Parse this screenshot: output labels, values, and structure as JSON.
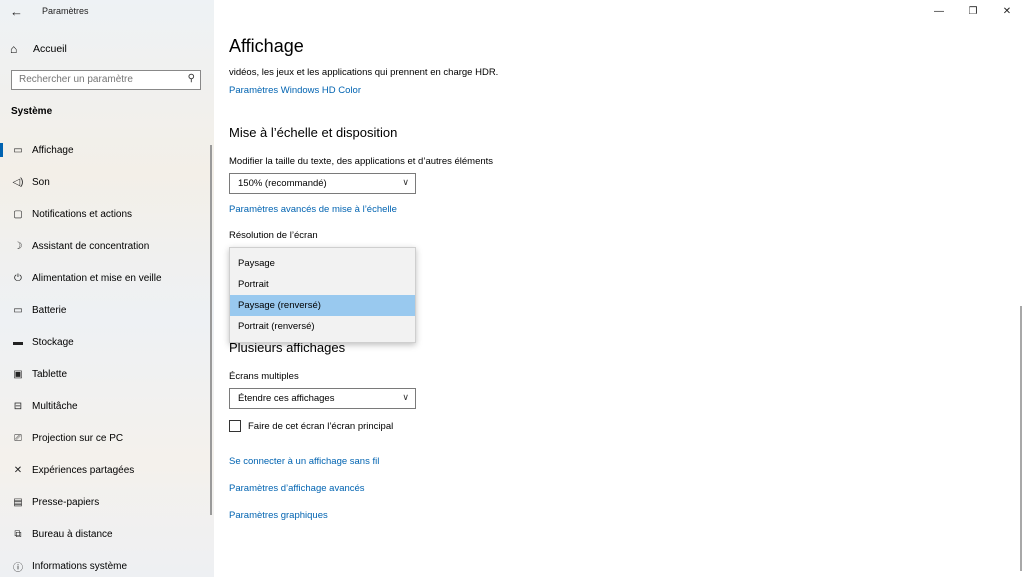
{
  "window": {
    "title": "Paramètres",
    "back_glyph": "←",
    "minimize": "—",
    "restore": "❐",
    "close": "✕"
  },
  "sidebar": {
    "home": "Accueil",
    "search_placeholder": "Rechercher un paramètre",
    "section": "Système",
    "items": [
      {
        "label": "Affichage",
        "icon": "display-icon"
      },
      {
        "label": "Son",
        "icon": "speaker-icon"
      },
      {
        "label": "Notifications et actions",
        "icon": "notification-icon"
      },
      {
        "label": "Assistant de concentration",
        "icon": "moon-icon"
      },
      {
        "label": "Alimentation et mise en veille",
        "icon": "power-icon"
      },
      {
        "label": "Batterie",
        "icon": "battery-icon"
      },
      {
        "label": "Stockage",
        "icon": "storage-icon"
      },
      {
        "label": "Tablette",
        "icon": "tablet-icon"
      },
      {
        "label": "Multitâche",
        "icon": "multitask-icon"
      },
      {
        "label": "Projection sur ce PC",
        "icon": "projection-icon"
      },
      {
        "label": "Expériences partagées",
        "icon": "shared-icon"
      },
      {
        "label": "Presse-papiers",
        "icon": "clipboard-icon"
      },
      {
        "label": "Bureau à distance",
        "icon": "remote-icon"
      },
      {
        "label": "Informations système",
        "icon": "info-icon"
      }
    ]
  },
  "main": {
    "title": "Affichage",
    "hdr_text": "vidéos, les jeux et les applications qui prennent en charge HDR.",
    "hdr_link": "Paramètres Windows HD Color",
    "scale_heading": "Mise à l’échelle et disposition",
    "scale_label": "Modifier la taille du texte, des applications et d’autres éléments",
    "scale_value": "150% (recommandé)",
    "scale_link": "Paramètres avancés de mise à l’échelle",
    "resolution_label": "Résolution de l’écran",
    "orientation_options": [
      "Paysage",
      "Portrait",
      "Paysage (renversé)",
      "Portrait (renversé)"
    ],
    "orientation_selected": "Paysage (renversé)",
    "multi_heading": "Plusieurs affichages",
    "multi_label": "Écrans multiples",
    "multi_value": "Étendre ces affichages",
    "primary_checkbox": "Faire de cet écran l’écran principal",
    "links": [
      "Se connecter à un affichage sans fil",
      "Paramètres d’affichage avancés",
      "Paramètres graphiques"
    ]
  },
  "colors": {
    "accent": "#0063b1",
    "selection": "#99c9ef"
  }
}
